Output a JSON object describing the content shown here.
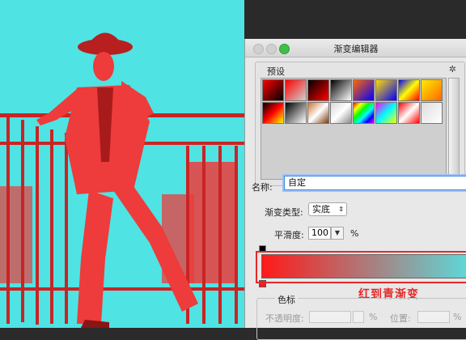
{
  "dialog": {
    "title": "渐变编辑器",
    "presets_label": "预设",
    "name_label": "名称:",
    "name_value": "自定",
    "gradient_type_label": "渐变类型:",
    "gradient_type_value": "实底",
    "smoothness_label": "平滑度:",
    "smoothness_value": "100",
    "smoothness_unit": "%",
    "color_stops_label": "色标",
    "opacity_label": "不透明度:",
    "opacity_unit": "%",
    "position_label": "位置:",
    "position_unit": "%",
    "annotation": "红到青渐变"
  },
  "gradient": {
    "start_color": "#ff1a1a",
    "end_color": "#5fd6d6"
  },
  "presets": [
    [
      "#ff0000,#000000",
      "#ff0000,#ffffff00",
      "#000000,#ff0000",
      "#000000,#ffffff",
      "#ff6600,#0000ff",
      "#ffdd00,#0000ff",
      "#0000ff,#ffff00,#ff0000",
      "#ffee00,#ff6600"
    ],
    [
      "#000000,#ff0000,#ffff00",
      "#000000,#ffffff",
      "#c87532,#ffffff,#7a3b10",
      "#d8d8d8,#ffffff,#8a8a8a",
      "#ff0000,#ffff00,#00ff00,#00ffff,#0000ff,#ff00ff",
      "#ff00ff,#00ffff,#ffff00",
      "#ff0000,#ffffff,#ff0000",
      "#dddddd,#ffffff"
    ]
  ],
  "colors": {
    "canvas_bg": "#4fe3e3",
    "figure": "#ee3b3b",
    "figure_dark": "#b81f1f"
  }
}
